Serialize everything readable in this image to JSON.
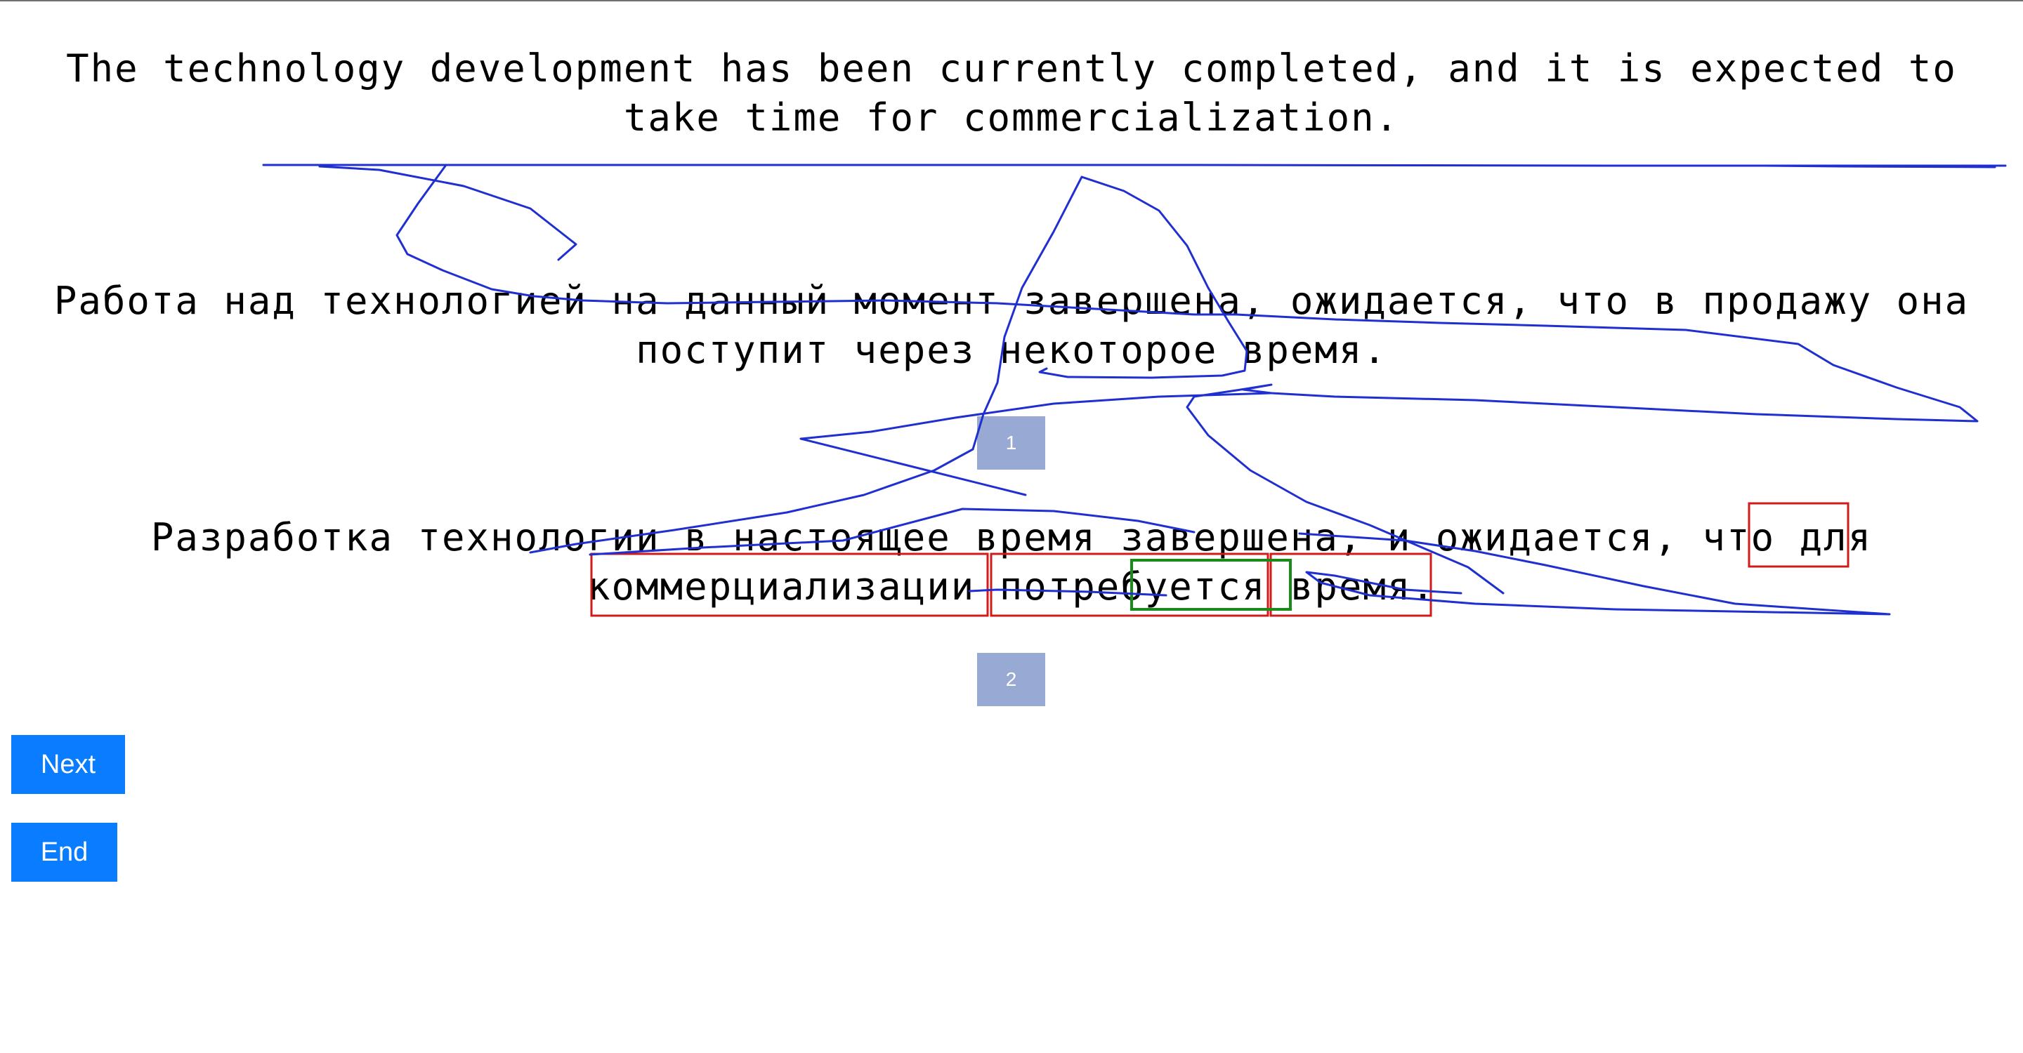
{
  "source_sentence": "The technology development has been currently completed, and it is expected to take time for commercialization.",
  "translations": [
    {
      "number": "1",
      "text": "Работа над технологией на данный момент завершена, ожидается, что в продажу она поступит через некоторое время."
    },
    {
      "number": "2",
      "text": "Разработка технологии в настоящее время завершена, и ожидается, что для коммерциализации потребуется время."
    }
  ],
  "buttons": {
    "next": "Next",
    "end": "End"
  },
  "annotation_colors": {
    "ink": "#1f2fd0",
    "error_box": "#d11a1a",
    "correct_box": "#1a8a1a",
    "badge": "#98a9d3",
    "button": "#0a7cff"
  }
}
